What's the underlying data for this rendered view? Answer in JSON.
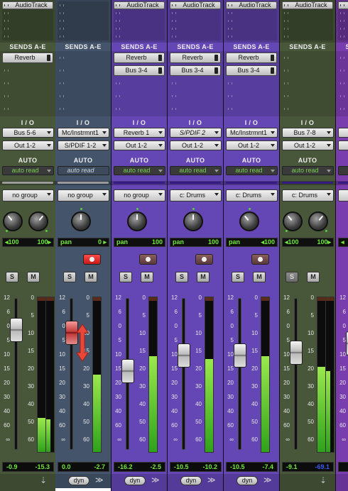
{
  "strips": [
    {
      "id": "s1",
      "theme": "green",
      "insert": "AudioTrack",
      "sends": [
        "Reverb"
      ],
      "io": {
        "input": "Bus 5-6",
        "output": "Out 1-2"
      },
      "auto": "auto read",
      "auto_dim": false,
      "group": "no group",
      "group_purple": false,
      "knobs": 2,
      "pan": {
        "left": "◂100",
        "right": "100▸"
      },
      "rec": false,
      "rec_active": false,
      "solo": "S",
      "mute": "M",
      "vol": "-0.9",
      "peak": "-15.3",
      "peak_blue": false,
      "fader_pos": 0.21,
      "meter": 0.22,
      "dyn": ""
    },
    {
      "id": "s2",
      "theme": "blue",
      "insert": "",
      "sends": [],
      "io": {
        "input": "Mc/Instrmnt1",
        "output": "S/PDIF 1-2"
      },
      "auto": "auto read",
      "auto_dim": true,
      "group": "no group",
      "group_purple": false,
      "knobs": 1,
      "pan": {
        "left": "pan",
        "right": "0 ▸"
      },
      "rec": true,
      "rec_active": true,
      "solo": "S",
      "mute": "M",
      "vol": "0.0",
      "peak": "-2.7",
      "peak_blue": false,
      "fader_pos": 0.23,
      "meter": 0.5,
      "dyn": "dyn"
    },
    {
      "id": "s3",
      "theme": "purple",
      "insert": "AudioTrack",
      "sends": [
        "Reverb",
        "Bus 3-4"
      ],
      "io": {
        "input": "Reverb 1",
        "output": "Out 1-2"
      },
      "auto": "auto read",
      "auto_dim": false,
      "group": "no group",
      "group_purple": true,
      "knobs": 1,
      "pan": {
        "left": "pan",
        "right": "100"
      },
      "rec": true,
      "rec_active": false,
      "solo": "S",
      "mute": "M",
      "vol": "-16.2",
      "peak": "-2.5",
      "peak_blue": false,
      "fader_pos": 0.48,
      "meter": 0.62,
      "dyn": "dyn"
    },
    {
      "id": "s4",
      "theme": "purple",
      "insert": "AudioTrack",
      "sends": [
        "Reverb",
        "Bus 3-4"
      ],
      "io": {
        "input": "S/PDIF 2",
        "output": "Out 1-2"
      },
      "auto": "auto read",
      "auto_dim": false,
      "group": "c: Drums",
      "group_purple": true,
      "knobs": 1,
      "pan": {
        "left": "pan",
        "right": "100"
      },
      "rec": true,
      "rec_active": false,
      "solo": "S",
      "mute": "M",
      "vol": "-10.5",
      "peak": "-10.2",
      "peak_blue": false,
      "fader_pos": 0.38,
      "meter": 0.6,
      "dyn": "dyn"
    },
    {
      "id": "s5",
      "theme": "purple",
      "insert": "AudioTrack",
      "sends": [
        "Reverb",
        "Bus 3-4"
      ],
      "io": {
        "input": "Mc/Instrmnt1",
        "output": "Out 1-2"
      },
      "auto": "auto read",
      "auto_dim": false,
      "group": "c: Drums",
      "group_purple": true,
      "knobs": 1,
      "pan": {
        "left": "pan",
        "right": "◂100"
      },
      "rec": true,
      "rec_active": false,
      "solo": "S",
      "mute": "M",
      "vol": "-10.5",
      "peak": "-7.4",
      "peak_blue": false,
      "fader_pos": 0.38,
      "meter": 0.62,
      "dyn": "dyn"
    },
    {
      "id": "s6",
      "theme": "green",
      "insert": "AudioTrack",
      "sends": [],
      "io": {
        "input": "Bus 7-8",
        "output": "Out 1-2"
      },
      "auto": "auto read",
      "auto_dim": false,
      "group": "c: Drums",
      "group_purple": true,
      "knobs": 2,
      "pan": {
        "left": "◂100",
        "right": "100▸"
      },
      "rec": false,
      "rec_active": false,
      "solo": "S",
      "mute": "M",
      "vol": "-9.1",
      "peak": "-69.1",
      "peak_blue": true,
      "fader_pos": 0.36,
      "meter": 0.55,
      "dyn": ""
    },
    {
      "id": "s7",
      "theme": "purple2",
      "insert": "AudioTrack",
      "sends": [],
      "io": {
        "input": "Ri",
        "output": "O"
      },
      "auto": "a",
      "auto_dim": false,
      "group": "",
      "group_purple": true,
      "knobs": 0,
      "pan": {
        "left": "◂",
        "right": ""
      },
      "rec": false,
      "rec_active": false,
      "solo": "",
      "mute": "",
      "vol": "",
      "peak": "",
      "peak_blue": false,
      "fader_pos": 0.3,
      "meter": 0.4,
      "dyn": ""
    }
  ],
  "labels": {
    "sends": "SENDS A-E",
    "io": "I / O",
    "auto": "AUTO"
  },
  "scale": [
    "12",
    "6",
    "0",
    "5",
    "10",
    "15",
    "20",
    "30",
    "40",
    "60",
    "∞"
  ],
  "meter_scale": [
    "0",
    "5",
    "10",
    "15",
    "20",
    "30",
    "40",
    "50",
    "60"
  ],
  "icons": {
    "ff": "fast-forward-icon",
    "down": "arrow-down-icon",
    "updown": "up-down-arrow-icon"
  }
}
